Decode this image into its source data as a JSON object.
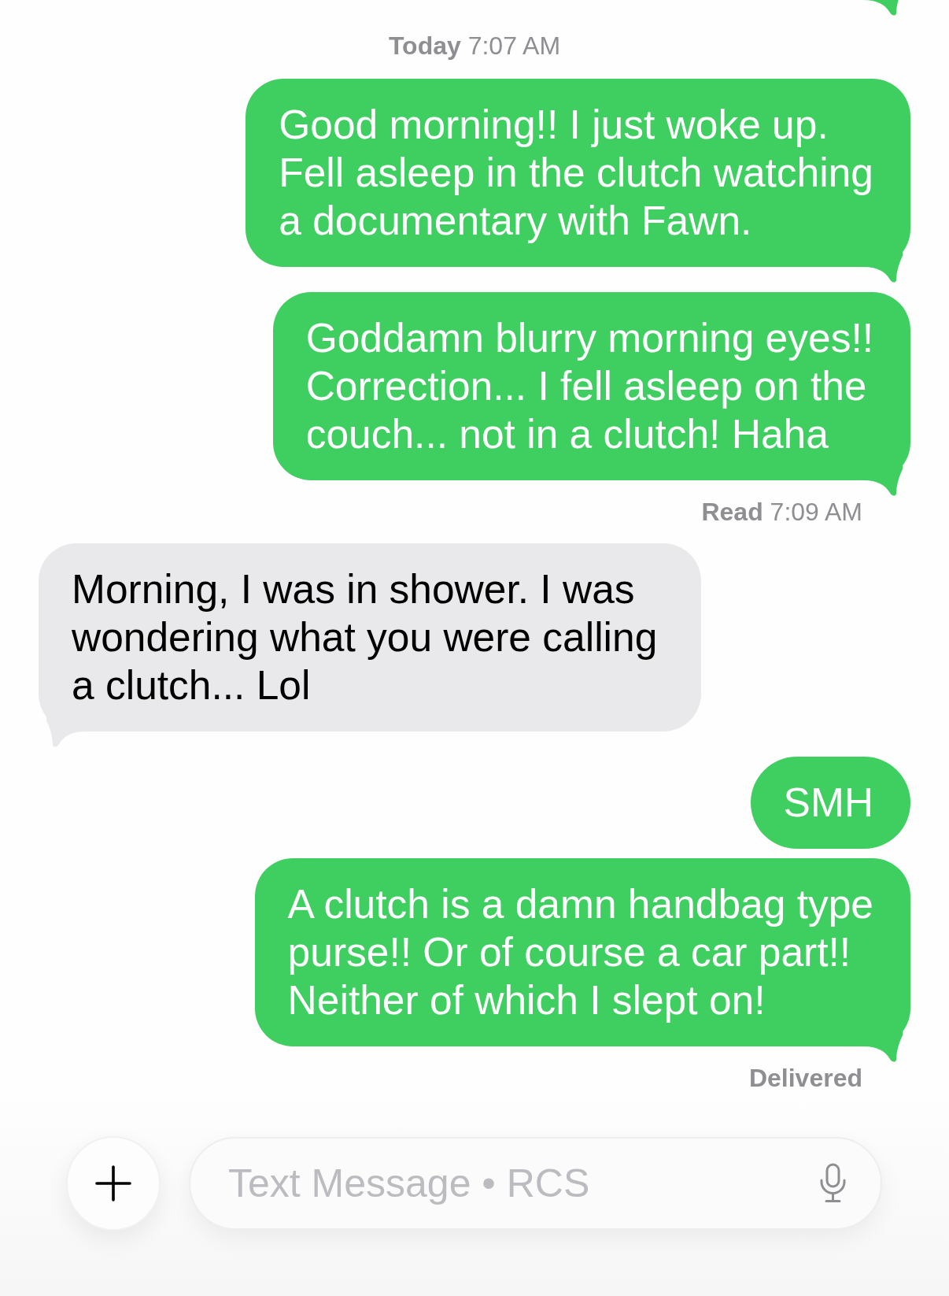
{
  "conversation": {
    "items": [
      {
        "kind": "timestamp",
        "day": "Today",
        "time": "7:07 AM"
      },
      {
        "kind": "sent",
        "tail": true,
        "text": "Good morning!! I just woke up.\nFell asleep in the clutch watching\na documentary with Fawn."
      },
      {
        "kind": "sent",
        "tail": true,
        "text": "Goddamn blurry morning eyes!!\nCorrection... I fell asleep on the\ncouch... not in a clutch! Haha"
      },
      {
        "kind": "receipt",
        "status": "Read",
        "time": "7:09 AM"
      },
      {
        "kind": "received",
        "tail": true,
        "text": "Morning, I was in shower. I was\nwondering what you were calling\na clutch... Lol"
      },
      {
        "kind": "sent",
        "tail": false,
        "text": "SMH"
      },
      {
        "kind": "sent",
        "tail": true,
        "text": "A clutch is a damn handbag type\npurse!! Or of course a car part!!\nNeither of which I slept on!"
      },
      {
        "kind": "receipt",
        "status": "Delivered"
      }
    ]
  },
  "composer": {
    "placeholder": "Text Message • RCS"
  }
}
